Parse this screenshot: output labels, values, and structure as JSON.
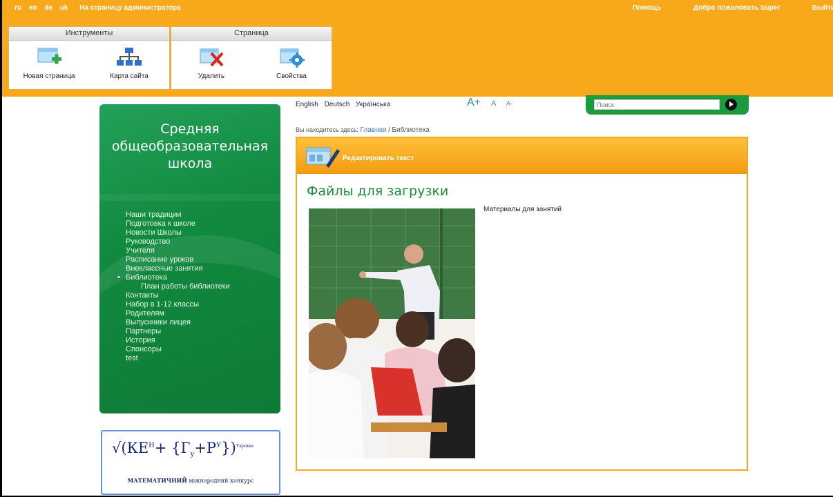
{
  "admin_bar": {
    "languages": [
      "ru",
      "en",
      "de",
      "uk"
    ],
    "admin_link": "На страницу администратора",
    "help": "Помощь",
    "welcome": "Добро пожаловать Super",
    "logout": "Выйти"
  },
  "tools_panel": {
    "title": "Инструменты",
    "new_page": "Новая страница",
    "sitemap": "Карта сайта"
  },
  "page_panel": {
    "title": "Страница",
    "delete": "Удалить",
    "properties": "Свойства"
  },
  "site": {
    "school_title_lines": [
      "Средняя",
      "общеобразовательная",
      "школа"
    ]
  },
  "menu": [
    "Наши традиции",
    "Подготовка к школе",
    "Новости Школы",
    "Руководство",
    "Учителя",
    "Расписание уроков",
    "Внеклассные занятия",
    "Библиотека",
    "План работы библиотеки",
    "Контакты",
    "Набор в 1-12 классы",
    "Родителям",
    "Выпускники лицея",
    "Партнеры",
    "История",
    "Спонсоры",
    "test"
  ],
  "banner": {
    "formula_main": "√(КЕ",
    "caption_bold": "МАТЕМАТИЧНИЙ",
    "caption_rest": "міжнародний конкурс",
    "tiny": "Україна"
  },
  "lang_switch": [
    "English",
    "Deutsch",
    "Українська"
  ],
  "font_size": {
    "large": "A+",
    "normal": "A",
    "small": "A-"
  },
  "search": {
    "placeholder": "Поиск"
  },
  "breadcrumb": {
    "prefix": "Вы находитесь здесь:",
    "home": "Главная",
    "separator": "/",
    "current": "Библиотека"
  },
  "content": {
    "edit_label": "Редактировать текст",
    "heading": "Файлы для загрузки",
    "text": "Материалы для занятий"
  },
  "colors": {
    "accent_orange": "#f7a81b",
    "green": "#118a3f",
    "link_blue": "#3b7fc4"
  }
}
